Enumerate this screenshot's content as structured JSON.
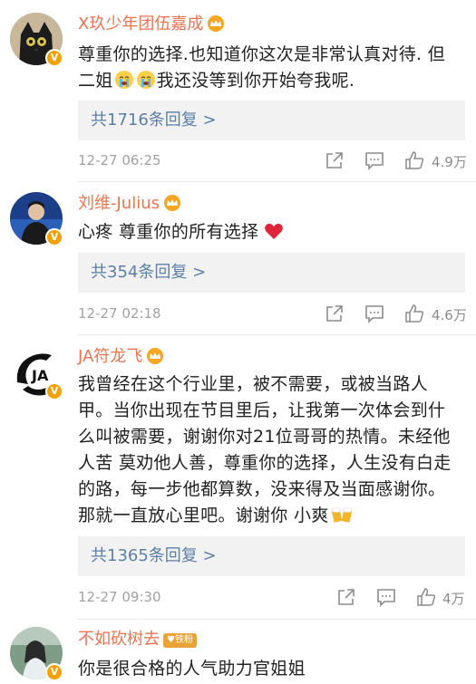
{
  "comments": [
    {
      "name": "X玖少年团伍嘉成",
      "text_lines": [
        "尊重你的选择.也知道你这次是非常认真对待. 但",
        "二姐",
        "我还没等到你开始夸我呢."
      ],
      "replies": "共1716条回复 >",
      "time": "12-27 06:25",
      "likes": "4.9万"
    },
    {
      "name": "刘维-Julius",
      "text": "心疼  尊重你的所有选择",
      "replies": "共354条回复 >",
      "time": "12-27 02:18",
      "likes": "4.6万"
    },
    {
      "name": "JA符龙飞",
      "text_lines": [
        "我曾经在这个行业里，被不需要，或被当路人",
        "甲。当你出现在节目里后，让我第一次体会到什",
        "么叫被需要，谢谢你对21位哥哥的热情。未经他",
        "人苦 莫劝他人善，尊重你的选择，人生没有白走",
        "的路，每一步他都算数，没来得及当面感谢你。",
        "那就一直放心里吧。谢谢你 小爽"
      ],
      "replies": "共1365条回复 >",
      "time": "12-27 09:30",
      "likes": "4万"
    },
    {
      "name": "不如砍树去",
      "badge": "铁粉",
      "text": "你是很合格的人气助力官姐姐"
    }
  ],
  "verified_mark": "V",
  "avatar_logo_text": "JA",
  "colors": {
    "name": "#eb7350",
    "reply_link": "#5d7fa7",
    "meta": "#a2a2a2",
    "badge": "#f2a100",
    "heart": "#e0243a"
  }
}
